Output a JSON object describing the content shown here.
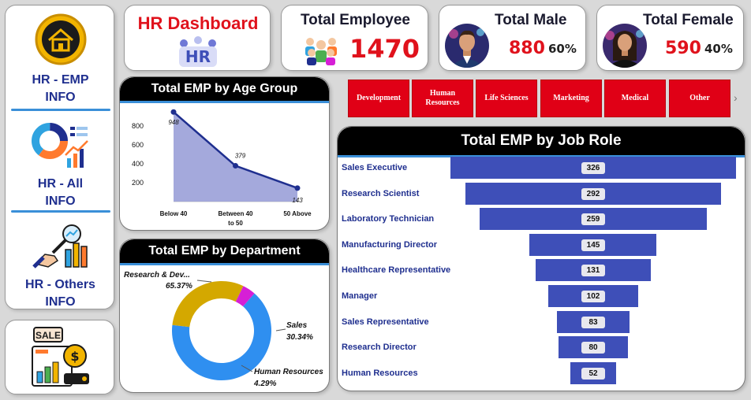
{
  "nav": {
    "items": [
      {
        "label_line1": "HR - EMP",
        "label_line2": "INFO",
        "icon": "home-icon"
      },
      {
        "label_line1": "HR - All",
        "label_line2": "INFO",
        "icon": "chart-report-icon"
      },
      {
        "label_line1": "HR - Others",
        "label_line2": "INFO",
        "icon": "analytics-magnifier-icon"
      }
    ],
    "sale_icon_text": "SALE",
    "sale_coin": "$"
  },
  "header": {
    "title": "HR Dashboard",
    "logo_text": "HR"
  },
  "kpis": {
    "total_employee": {
      "title": "Total Employee",
      "value": "1470"
    },
    "total_male": {
      "title": "Total Male",
      "value": "880",
      "pct": "60%"
    },
    "total_female": {
      "title": "Total Female",
      "value": "590",
      "pct": "40%"
    }
  },
  "departments": [
    "Development",
    "Human Resources",
    "Life Sciences",
    "Marketing",
    "Medical",
    "Other"
  ],
  "colors": {
    "accent_red": "#e0121c",
    "nav_blue": "#1f2f8f",
    "bar_blue": "#3e4fb8",
    "area_fill": "#9aa0d8",
    "donut_blue": "#2f8ff0",
    "donut_gold": "#d4a800",
    "donut_magenta": "#d61fd6"
  },
  "chart_data": [
    {
      "type": "area",
      "title": "Total EMP by Age Group",
      "categories": [
        "Below 40",
        "Between 40 to 50",
        "50 Above"
      ],
      "values": [
        948,
        379,
        143
      ],
      "data_labels": [
        "948",
        "379",
        "143"
      ],
      "y_ticks": [
        "200",
        "400",
        "600",
        "800"
      ],
      "ylim": [
        0,
        1000
      ]
    },
    {
      "type": "pie",
      "title": "Total EMP by Department",
      "categories": [
        "Research & Dev...",
        "Sales",
        "Human Resources"
      ],
      "values": [
        65.37,
        30.34,
        4.29
      ],
      "data_labels": [
        "65.37%",
        "30.34%",
        "4.29%"
      ]
    },
    {
      "type": "bar",
      "title": "Total EMP by Job Role",
      "categories": [
        "Sales Executive",
        "Research Scientist",
        "Laboratory Technician",
        "Manufacturing Director",
        "Healthcare Representative",
        "Manager",
        "Sales Representative",
        "Research Director",
        "Human Resources"
      ],
      "values": [
        326,
        292,
        259,
        145,
        131,
        102,
        83,
        80,
        52
      ]
    }
  ]
}
